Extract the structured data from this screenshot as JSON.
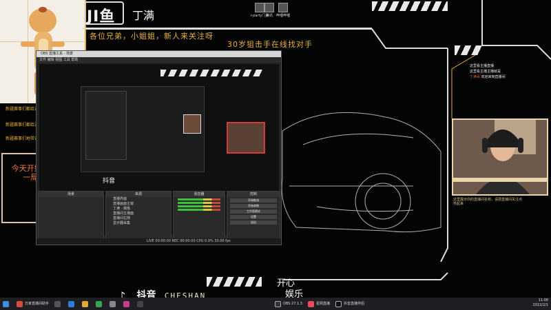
{
  "banner": {
    "logo_text": "JI鱼",
    "streamer_name": "丁满",
    "slogan": "各位兄弟，小姐姐，新人来关注呀",
    "subtitle": "30岁狙击手在线找对手"
  },
  "desktop_icons": [
    {
      "label": "r-party门头"
    },
    {
      "label": "腾讯"
    },
    {
      "label": "哔哩哔哩"
    }
  ],
  "left_notes": [
    "新疆赛事们都给过游戏有奖对应等待",
    "新疆赛事们都给过游戏有奖对应等待",
    "新疆赛事们地带请有奖励直播"
  ],
  "message_box": {
    "text": "今天开始 认真对待每一局 再不叼泡"
  },
  "obs": {
    "title": "OBS 直播工具 - 场景",
    "menu": "文件  编辑  视图  工具  帮助",
    "panels": {
      "scenes": "场景",
      "sources": "来源",
      "mixer": "混音器",
      "transitions": "转场",
      "controls": "控制"
    },
    "sources": [
      "直播界面",
      "直播画面主窗",
      "丁满 - 摄像",
      "直播间主播面",
      "直播间右侧",
      "显示器采集"
    ],
    "controls": [
      "开始推流",
      "开始录制",
      "工作室模式",
      "设置",
      "退出"
    ],
    "status": "LIVE 00:00:00   REC 00:00:00   CPU 0.9%  30.00 fps"
  },
  "tiktok": {
    "brand": "抖音",
    "english": "CHESHAN"
  },
  "happy_text": [
    "开心",
    "娱乐"
  ],
  "chat": [
    {
      "user": "",
      "text": "这里看主播直播"
    },
    {
      "user": "",
      "text": "这里看主播主播就是"
    },
    {
      "user": "丁满哥",
      "text": "欢迎来到直播间"
    }
  ],
  "cam_note": "这里展示你的直播间名称，请把直播间关注点亮起来",
  "taskbar": {
    "items": [
      "万家直播间助手",
      "",
      "",
      "",
      "",
      "",
      "",
      "",
      "OBS 27.1.3",
      "星网直播",
      "抖音直播伴侣"
    ],
    "time": "11:08",
    "date": "2022/2/1"
  },
  "colors": {
    "accent": "#e8b23a",
    "warning": "#f07a3c",
    "panel": "#2a2a2a"
  }
}
